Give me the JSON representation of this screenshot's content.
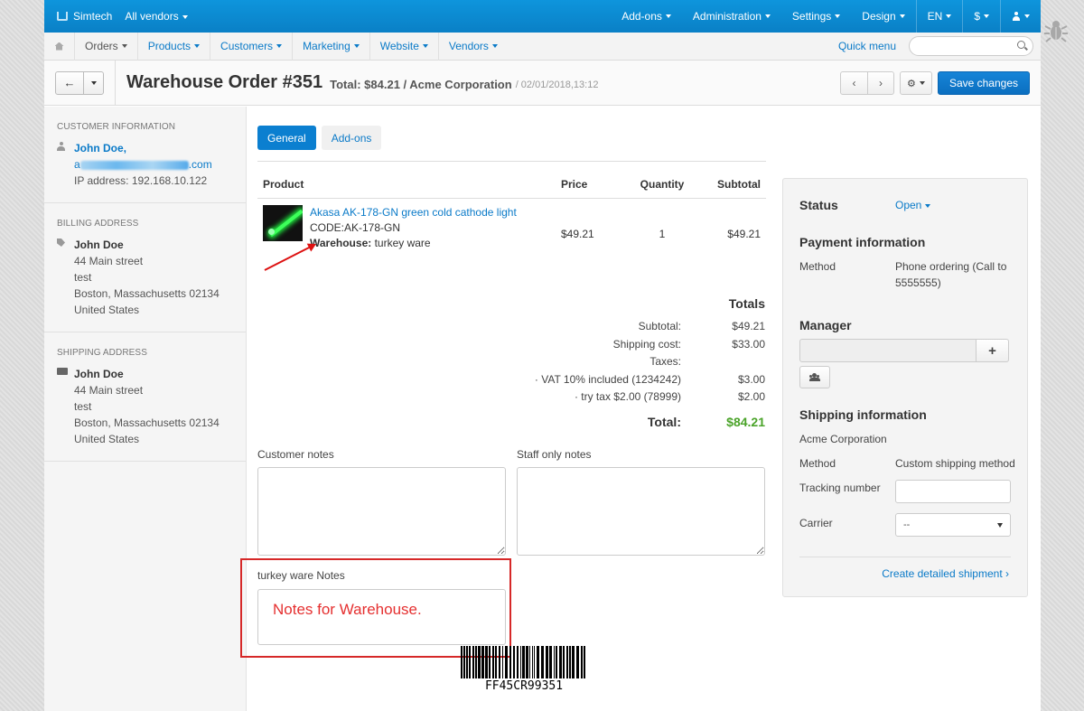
{
  "topbar": {
    "brand": "Simtech",
    "vendors": "All vendors",
    "menus": [
      "Add-ons",
      "Administration",
      "Settings",
      "Design",
      "EN",
      "$"
    ]
  },
  "nav": {
    "items": [
      "Orders",
      "Products",
      "Customers",
      "Marketing",
      "Website",
      "Vendors"
    ],
    "quick_menu": "Quick menu"
  },
  "header": {
    "title": "Warehouse Order #351",
    "subtitle": "Total: $84.21 / Acme Corporation",
    "date": "/ 02/01/2018,13:12",
    "save": "Save changes"
  },
  "sidebar": {
    "customer": {
      "heading": "CUSTOMER INFORMATION",
      "name": "John Doe,",
      "email_prefix": "a",
      "email_suffix": ".com",
      "ip": "IP address: 192.168.10.122"
    },
    "billing": {
      "heading": "BILLING ADDRESS",
      "name": "John Doe",
      "street": "44 Main street",
      "line2": "test",
      "city": "Boston, Massachusetts 02134",
      "country": "United States"
    },
    "shipping": {
      "heading": "SHIPPING ADDRESS",
      "name": "John Doe",
      "street": "44 Main street",
      "line2": "test",
      "city": "Boston, Massachusetts 02134",
      "country": "United States"
    }
  },
  "tabs": [
    "General",
    "Add-ons"
  ],
  "products": {
    "headers": [
      "Product",
      "Price",
      "Quantity",
      "Subtotal"
    ],
    "rows": [
      {
        "name": "Akasa AK-178-GN green cold cathode light",
        "code": "CODE:AK-178-GN",
        "warehouse_label": "Warehouse:",
        "warehouse": "turkey ware",
        "price": "$49.21",
        "qty": "1",
        "subtotal": "$49.21"
      }
    ]
  },
  "totals": {
    "heading": "Totals",
    "subtotal_label": "Subtotal:",
    "subtotal": "$49.21",
    "shipping_label": "Shipping cost:",
    "shipping": "$33.00",
    "taxes_label": "Taxes:",
    "vat_label": "· VAT 10% included (1234242)",
    "vat": "$3.00",
    "trytax_label": "· try tax  $2.00  (78999)",
    "trytax": "$2.00",
    "total_label": "Total:",
    "total": "$84.21"
  },
  "notes": {
    "customer_label": "Customer notes",
    "staff_label": "Staff only notes",
    "warehouse_label": "turkey ware Notes",
    "warehouse_value": "Notes for Warehouse."
  },
  "barcode": "FF45CR99351",
  "panel": {
    "status_label": "Status",
    "status_value": "Open",
    "payment_heading": "Payment information",
    "method_label": "Method",
    "payment_method": "Phone ordering (Call to 5555555)",
    "manager_heading": "Manager",
    "shipping_heading": "Shipping information",
    "shipping_company": "Acme Corporation",
    "shipping_method_label": "Method",
    "shipping_method": "Custom shipping method",
    "tracking_label": "Tracking number",
    "carrier_label": "Carrier",
    "carrier_value": "--",
    "create_shipment": "Create detailed shipment ›"
  },
  "colors": {
    "topbar": "#0b8bd2",
    "link": "#0a7ac8",
    "total_green": "#4aa329",
    "highlight_red": "#d62828"
  }
}
